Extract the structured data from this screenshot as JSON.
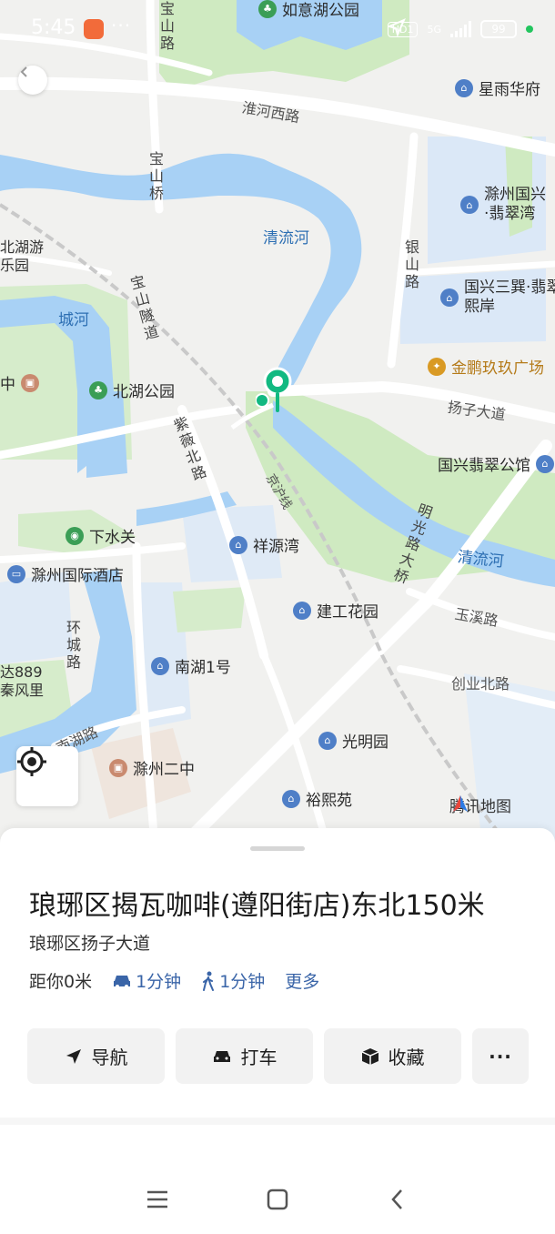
{
  "status_bar": {
    "time": "5:45",
    "app_icon": "app-notification-icon",
    "dots": "···",
    "hd_badge": "HD1",
    "network": "5G",
    "battery": "99"
  },
  "map": {
    "water_labels": [
      "清流河",
      "城河",
      "清流河"
    ],
    "roads": {
      "huaihe_west": "淮河西路",
      "baoshan_road": "宝山路",
      "baoshan_bridge": "宝山桥",
      "baoshan_tunnel": "宝山隧道",
      "yinshan_road": "银山路",
      "yangzi_avenue": "扬子大道",
      "ziwei_north": "紫薇北路",
      "jinghu_line": "京沪线",
      "mingguang_bridge": "明光路大桥",
      "yuxi_road": "玉溪路",
      "chuangye_north": "创业北路",
      "huancheng_road": "环城路",
      "nanhu_road": "南湖路"
    },
    "pois": {
      "ruyi_park": "如意湖公园",
      "xingyu_huafu": "星雨华府",
      "chuzhou_guoxing": "滁州国兴·翡翠湾",
      "beihu_amusement": "北湖游乐园",
      "guoxing_sanxun": "国兴三巽·翡翠熙岸",
      "jinpeng_plaza": "金鹏玖玖广场",
      "beihu_park": "北湖公园",
      "guoxing_feicui_hall": "国兴翡翠公馆",
      "middle_school_partial": "中",
      "xiashuiguan": "下水关",
      "xiangyuan_bay": "祥源湾",
      "chuzhou_hotel": "滁州国际酒店",
      "jiangong_garden": "建工花园",
      "wanda_partial": "达889",
      "feng_partial": "秦风里",
      "nanhu_one": "南湖1号",
      "guangming_garden": "光明园",
      "chuzhou_no2_middle": "滁州二中",
      "yuxi_yuan": "裕熙苑"
    },
    "logo_text": "腾讯地图",
    "marker": "location-pin-icon"
  },
  "place": {
    "title": "琅琊区揭瓦咖啡(遵阳街店)东北150米",
    "address": "琅琊区扬子大道",
    "distance": "距你0米",
    "drive_time": "1分钟",
    "walk_time": "1分钟",
    "more": "更多"
  },
  "actions": {
    "navigate": "导航",
    "taxi": "打车",
    "favorite": "收藏",
    "more": "···"
  },
  "colors": {
    "water": "#a8d1f5",
    "park": "#cfeac1",
    "road": "#ffffff",
    "marker_green": "#12b981",
    "accent_blue": "#3a65a8"
  }
}
